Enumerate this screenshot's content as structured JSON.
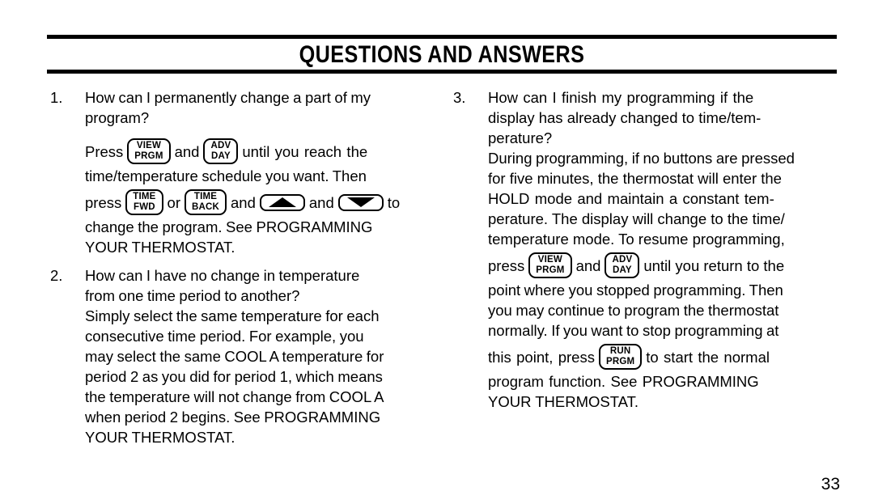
{
  "document": {
    "title": "QUESTIONS AND ANSWERS",
    "page_number": "33"
  },
  "keycaps": {
    "view_prgm": {
      "line1": "VIEW",
      "line2": "PRGM"
    },
    "adv_day": {
      "line1": "ADV",
      "line2": "DAY"
    },
    "time_fwd": {
      "line1": "TIME",
      "line2": "FWD"
    },
    "time_back": {
      "line1": "TIME",
      "line2": "BACK"
    },
    "run_prgm": {
      "line1": "RUN",
      "line2": "PRGM"
    },
    "up_arrow": "▲",
    "down_arrow": "▼"
  },
  "left_column": {
    "item1": {
      "number": "1.",
      "question_line1": "How can I permanently change a part of my",
      "question_line2": "program?",
      "answer_press_word": "Press",
      "answer_after_buttons": "until you reach the",
      "answer_line_2": "time/temperature schedule you want.  Then",
      "answer_press_word2": "press",
      "answer_or_word": "or",
      "answer_and_word1": "and",
      "answer_and_word2": "and",
      "answer_to_word": "to",
      "answer_line_4": "change the program.  See PROGRAMMING",
      "answer_line_5": "YOUR THERMOSTAT."
    },
    "item2": {
      "number": "2.",
      "question_line1": "How can I have no change in temperature",
      "question_line2": "from one time period to another?",
      "answer_line_1": "Simply select the same temperature for each",
      "answer_line_2": "consecutive time period.  For example,  you",
      "answer_line_3": "may select the same COOL A temperature for",
      "answer_line_4": "period 2 as you did for period 1, which means",
      "answer_line_5": "the temperature will not change from COOL A",
      "answer_line_6": "when period 2 begins.  See PROGRAMMING",
      "answer_line_7": "YOUR THERMOSTAT."
    }
  },
  "right_column": {
    "item3": {
      "number": "3.",
      "question_line1": "How can I finish my programming if the",
      "question_line2": "display has already changed to time/tem-",
      "question_line3": "perature?",
      "answer_line_1": "During programming, if no buttons are pressed",
      "answer_line_2": "for five minutes, the thermostat will enter the",
      "answer_line_3": "HOLD mode and maintain a constant tem-",
      "answer_line_4": "perature.  The display will change to the time/",
      "answer_line_5": "temperature mode. To resume programming,",
      "answer_press_word": "press",
      "answer_and_word": "and",
      "answer_after_buttons": "until you return to the",
      "answer_line_7": "point where you stopped programming.  Then",
      "answer_line_8": "you may continue to program the thermostat",
      "answer_line_9": "normally.  If you want to stop programming at",
      "answer_this_point": "this point, press",
      "answer_after_run": "to start the normal",
      "answer_line_11": "program function.   See PROGRAMMING",
      "answer_line_12": "YOUR THERMOSTAT."
    }
  }
}
